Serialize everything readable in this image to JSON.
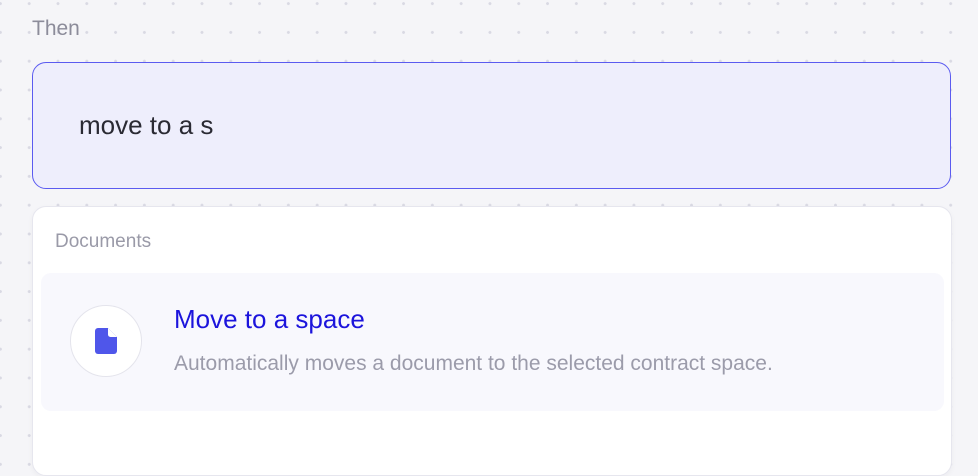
{
  "section": {
    "label": "Then"
  },
  "search": {
    "value": "move to a s"
  },
  "dropdown": {
    "group_label": "Documents",
    "options": [
      {
        "icon": "document-icon",
        "title": "Move to a space",
        "description": "Automatically moves a document to the selected contract space."
      }
    ]
  },
  "colors": {
    "accent": "#5b5bf0",
    "title": "#1c14dc",
    "icon": "#4f56ea",
    "input_bg": "#eeeefc"
  }
}
